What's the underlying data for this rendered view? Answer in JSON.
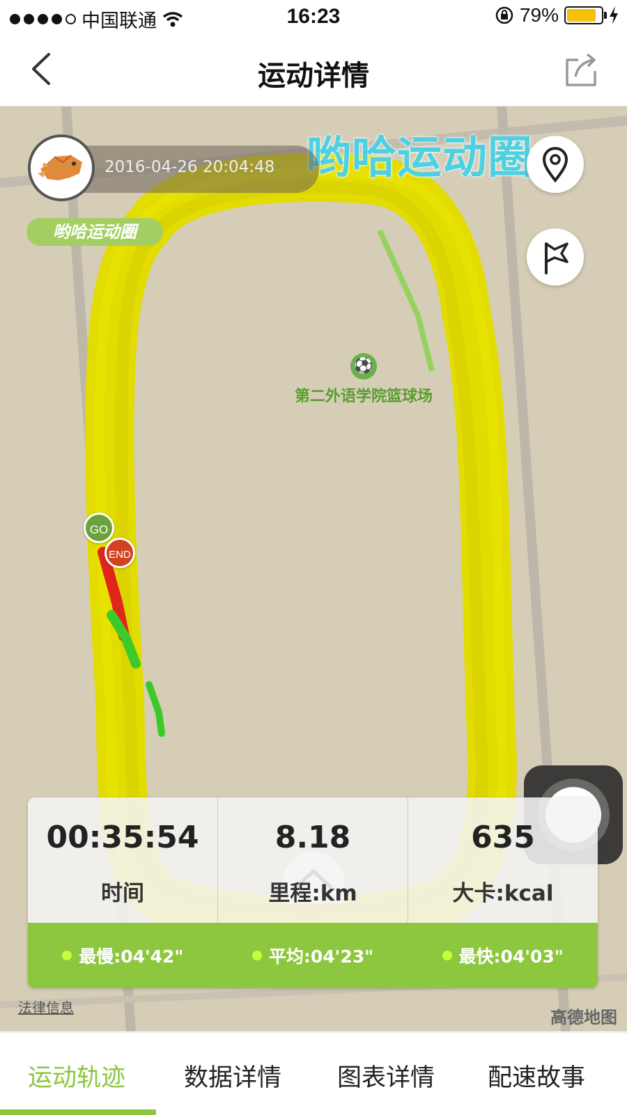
{
  "status_bar": {
    "carrier": "中国联通",
    "time": "16:23",
    "battery": "79%",
    "signal_icon": "signal-dots-icon",
    "wifi_icon": "wifi-icon",
    "lock_icon": "rotation-lock-icon",
    "charging_icon": "charging-bolt-icon"
  },
  "header": {
    "title": "运动详情",
    "back_icon": "chevron-left-icon",
    "share_icon": "share-icon"
  },
  "map": {
    "watermark": "哟哈运动圈",
    "timestamp": "2016-04-26 20:04:48",
    "brand_tag": "哟哈运动圈",
    "poi_name": "第二外语学院篮球场",
    "start_marker": "GO",
    "end_marker": "END",
    "legal_link": "法律信息",
    "map_provider": "高德地图",
    "location_button_icon": "location-pin-icon",
    "flag_button_icon": "flag-icon",
    "expand_icon": "chevron-up-icon"
  },
  "stats": {
    "time_value": "00:35:54",
    "time_label": "时间",
    "distance_value": "8.18",
    "distance_label": "里程:km",
    "calories_value": "635",
    "calories_label": "大卡:kcal"
  },
  "pace": {
    "slowest": "最慢:04'42\"",
    "average": "平均:04'23\"",
    "fastest": "最快:04'03\""
  },
  "tabs": [
    {
      "label": "运动轨迹",
      "active": true
    },
    {
      "label": "数据详情",
      "active": false
    },
    {
      "label": "图表详情",
      "active": false
    },
    {
      "label": "配速故事",
      "active": false
    }
  ],
  "colors": {
    "accent": "#8dc63f",
    "track": "#e2dc00",
    "map_bg": "#d6cdb7",
    "watermark": "#4dd0e1"
  }
}
